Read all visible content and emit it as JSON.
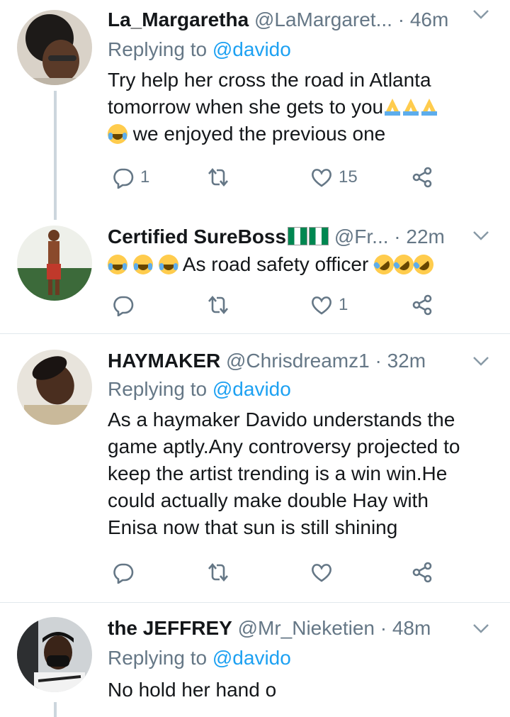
{
  "tweets": [
    {
      "name": "La_Margaretha",
      "handle": "@LaMargaret...",
      "time": "46m",
      "replying_label": "Replying to ",
      "replying_user": "@davido",
      "lines": [
        "Try help her cross the road in Atlanta",
        "tomorrow when she gets to you",
        "we enjoyed the previous one"
      ],
      "reply_count": "1",
      "retweet_count": "",
      "like_count": "15"
    },
    {
      "name": "Certified SureBoss",
      "handle": "@Fr...",
      "time": "22m",
      "text": "As road safety officer",
      "reply_count": "",
      "retweet_count": "",
      "like_count": "1"
    },
    {
      "name": "HAYMAKER",
      "handle": "@Chrisdreamz1",
      "time": "32m",
      "replying_label": "Replying to ",
      "replying_user": "@davido",
      "lines": [
        "As a haymaker Davido understands the",
        "game aptly.Any controversy projected to",
        "keep the artist trending is a win win.He",
        "could actually make double Hay with",
        "Enisa now that sun is still shining"
      ],
      "reply_count": "",
      "retweet_count": "",
      "like_count": ""
    },
    {
      "name": "the JEFFREY",
      "handle": "@Mr_Nieketien",
      "time": "48m",
      "replying_label": "Replying to ",
      "replying_user": "@davido",
      "text": "No hold her hand o"
    }
  ],
  "separator": " · ",
  "icons": [
    "reply-icon",
    "retweet-icon",
    "like-icon",
    "share-icon",
    "chevron-down-icon",
    "folded-hands-emoji",
    "laughing-emoji",
    "rofl-emoji",
    "nigeria-flag-emoji"
  ],
  "colors": {
    "link": "#1da1f2",
    "muted": "#657786",
    "text": "#14171a",
    "divider": "#e1e8ed",
    "thread_line": "#ccd6dd"
  }
}
